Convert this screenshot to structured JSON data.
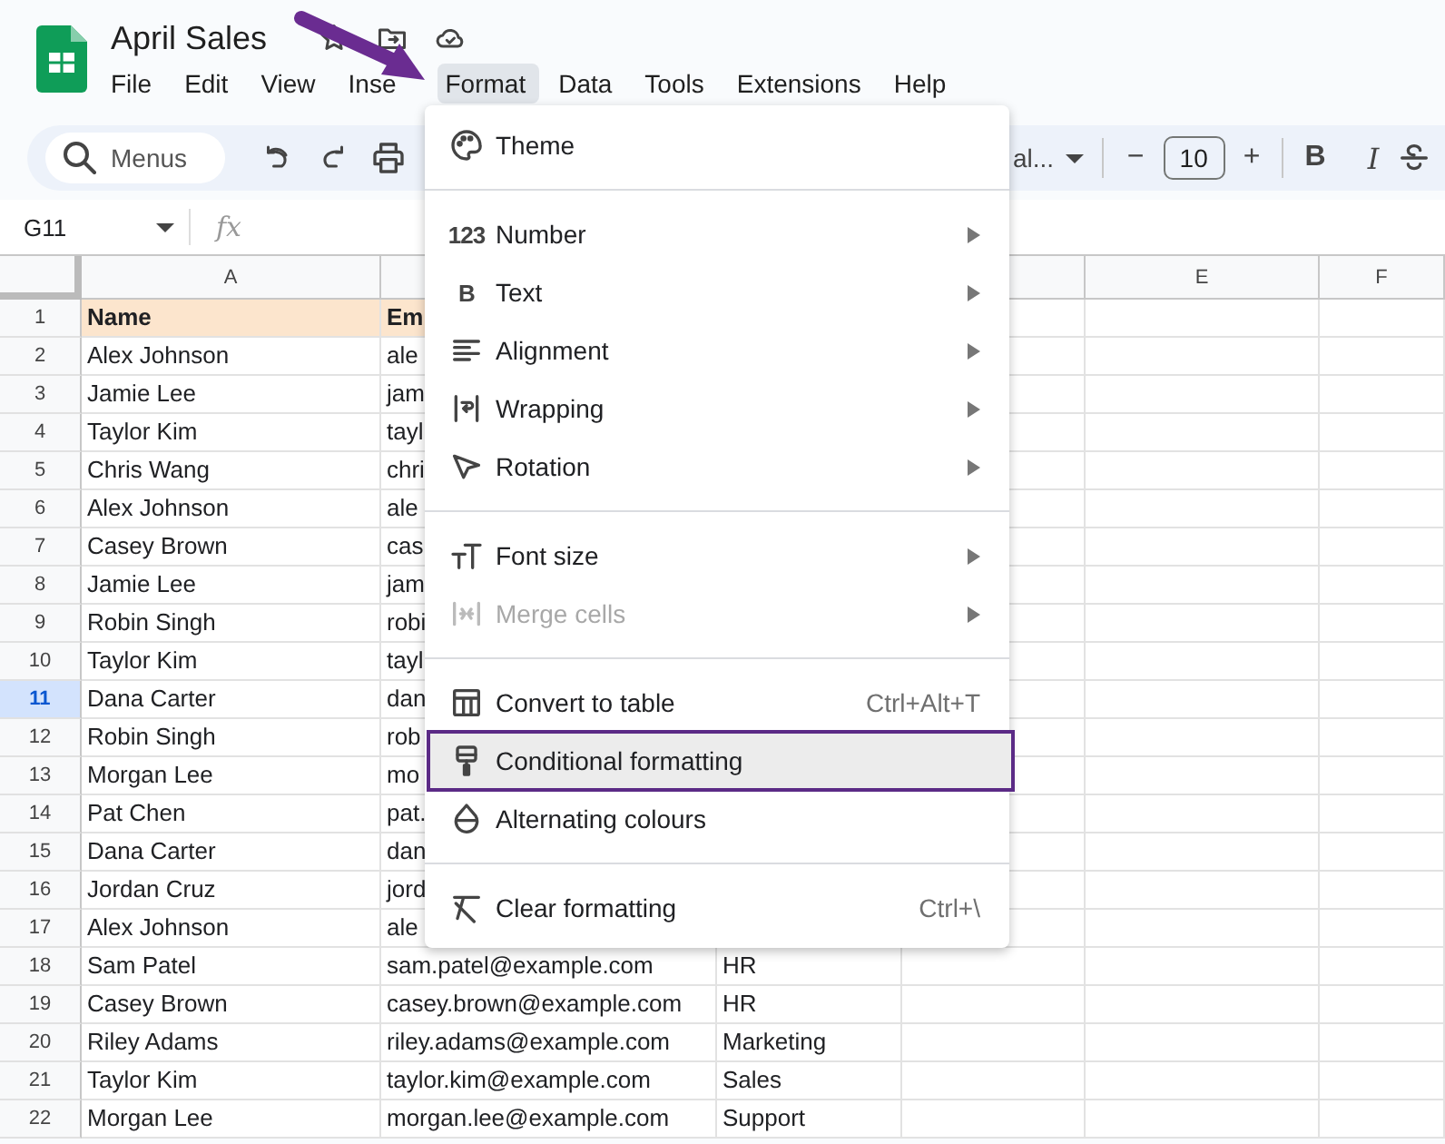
{
  "document": {
    "title": "April Sales"
  },
  "menu_bar": [
    {
      "label": "File",
      "selected": false
    },
    {
      "label": "Edit",
      "selected": false
    },
    {
      "label": "View",
      "selected": false
    },
    {
      "label": "Inse",
      "selected": false
    },
    {
      "label": "Format",
      "selected": true
    },
    {
      "label": "Data",
      "selected": false
    },
    {
      "label": "Tools",
      "selected": false
    },
    {
      "label": "Extensions",
      "selected": false
    },
    {
      "label": "Help",
      "selected": false
    }
  ],
  "toolbar": {
    "search": {
      "placeholder": "Menus"
    },
    "font": "al...",
    "font_size": "10",
    "minus": "−",
    "plus": "+",
    "bold": "B",
    "italic": "I"
  },
  "formula_bar": {
    "cell_ref": "G11",
    "fx": "fx"
  },
  "sheet": {
    "columns": [
      "A",
      null,
      null,
      null,
      "E",
      "F"
    ],
    "rows": [
      {
        "number": "1",
        "header": true,
        "selected": false,
        "cells": [
          "Name",
          "Em"
        ]
      },
      {
        "number": "2",
        "header": false,
        "selected": false,
        "cells": [
          "Alex Johnson",
          "ale"
        ]
      },
      {
        "number": "3",
        "header": false,
        "selected": false,
        "cells": [
          "Jamie Lee",
          "jam"
        ]
      },
      {
        "number": "4",
        "header": false,
        "selected": false,
        "cells": [
          "Taylor Kim",
          "tayl"
        ]
      },
      {
        "number": "5",
        "header": false,
        "selected": false,
        "cells": [
          "Chris Wang",
          "chri"
        ]
      },
      {
        "number": "6",
        "header": false,
        "selected": false,
        "cells": [
          "Alex Johnson",
          "ale"
        ]
      },
      {
        "number": "7",
        "header": false,
        "selected": false,
        "cells": [
          "Casey Brown",
          "cas"
        ]
      },
      {
        "number": "8",
        "header": false,
        "selected": false,
        "cells": [
          "Jamie Lee",
          "jam"
        ]
      },
      {
        "number": "9",
        "header": false,
        "selected": false,
        "cells": [
          "Robin Singh",
          "robi"
        ]
      },
      {
        "number": "10",
        "header": false,
        "selected": false,
        "cells": [
          "Taylor Kim",
          "tayl"
        ]
      },
      {
        "number": "11",
        "header": false,
        "selected": true,
        "cells": [
          "Dana Carter",
          "dan"
        ]
      },
      {
        "number": "12",
        "header": false,
        "selected": false,
        "cells": [
          "Robin Singh",
          "rob"
        ]
      },
      {
        "number": "13",
        "header": false,
        "selected": false,
        "cells": [
          "Morgan Lee",
          "mo"
        ]
      },
      {
        "number": "14",
        "header": false,
        "selected": false,
        "cells": [
          "Pat Chen",
          "pat."
        ]
      },
      {
        "number": "15",
        "header": false,
        "selected": false,
        "cells": [
          "Dana Carter",
          "dan"
        ]
      },
      {
        "number": "16",
        "header": false,
        "selected": false,
        "cells": [
          "Jordan Cruz",
          "jord"
        ]
      },
      {
        "number": "17",
        "header": false,
        "selected": false,
        "cells": [
          "Alex Johnson",
          "ale"
        ]
      },
      {
        "number": "18",
        "header": false,
        "selected": false,
        "cells": [
          "Sam Patel",
          "sam.patel@example.com",
          "HR"
        ]
      },
      {
        "number": "19",
        "header": false,
        "selected": false,
        "cells": [
          "Casey Brown",
          "casey.brown@example.com",
          "HR"
        ]
      },
      {
        "number": "20",
        "header": false,
        "selected": false,
        "cells": [
          "Riley Adams",
          "riley.adams@example.com",
          "Marketing"
        ]
      },
      {
        "number": "21",
        "header": false,
        "selected": false,
        "cells": [
          "Taylor Kim",
          "taylor.kim@example.com",
          "Sales"
        ]
      },
      {
        "number": "22",
        "header": false,
        "selected": false,
        "cells": [
          "Morgan Lee",
          "morgan.lee@example.com",
          "Support"
        ]
      }
    ]
  },
  "format_menu": [
    {
      "kind": "item",
      "label": "Theme",
      "submenu": false,
      "disabled": false,
      "selected": false
    },
    {
      "kind": "separator"
    },
    {
      "kind": "item",
      "label": "Number",
      "glyph": "123",
      "submenu": true,
      "disabled": false,
      "selected": false
    },
    {
      "kind": "item",
      "label": "Text",
      "glyph": "B",
      "submenu": true,
      "disabled": false,
      "selected": false
    },
    {
      "kind": "item",
      "label": "Alignment",
      "submenu": true,
      "disabled": false,
      "selected": false
    },
    {
      "kind": "item",
      "label": "Wrapping",
      "submenu": true,
      "disabled": false,
      "selected": false
    },
    {
      "kind": "item",
      "label": "Rotation",
      "submenu": true,
      "disabled": false,
      "selected": false
    },
    {
      "kind": "separator"
    },
    {
      "kind": "item",
      "label": "Font size",
      "submenu": true,
      "disabled": false,
      "selected": false
    },
    {
      "kind": "item",
      "label": "Merge cells",
      "submenu": true,
      "disabled": true,
      "selected": false
    },
    {
      "kind": "separator"
    },
    {
      "kind": "item",
      "label": "Convert to table",
      "shortcut": "Ctrl+Alt+T",
      "submenu": false,
      "disabled": false,
      "selected": false
    },
    {
      "kind": "item",
      "label": "Conditional formatting",
      "submenu": false,
      "disabled": false,
      "selected": true
    },
    {
      "kind": "item",
      "label": "Alternating colours",
      "submenu": false,
      "disabled": false,
      "selected": false
    },
    {
      "kind": "separator"
    },
    {
      "kind": "item",
      "label": "Clear formatting",
      "shortcut": "Ctrl+\\",
      "submenu": false,
      "disabled": false,
      "selected": false
    }
  ]
}
